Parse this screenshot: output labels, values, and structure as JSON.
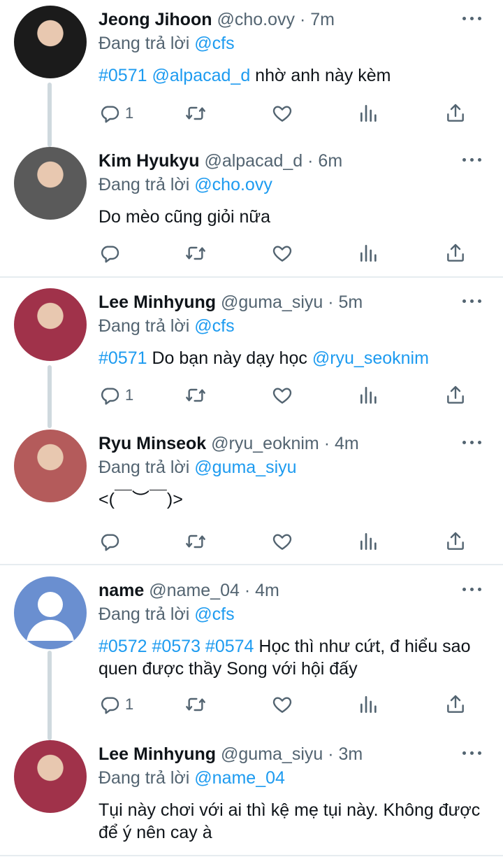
{
  "reply_prefix": "Đang trả lời",
  "tweets": [
    {
      "name": "Jeong Jihoon",
      "handle": "@cho.ovy",
      "time": "7m",
      "reply_to": "@cfs",
      "body_parts": [
        {
          "text": "#0571 @alpacad_d",
          "link": true
        },
        {
          "text": " nhờ anh này kèm",
          "link": false
        }
      ],
      "reply_count": "1",
      "avatar_color": "#1b1b1b"
    },
    {
      "name": "Kim Hyukyu",
      "handle": "@alpacad_d",
      "time": "6m",
      "reply_to": "@cho.ovy",
      "body_parts": [
        {
          "text": "Do mèo cũng giỏi nữa",
          "link": false
        }
      ],
      "reply_count": "",
      "avatar_color": "#5a5a5a"
    },
    {
      "name": "Lee Minhyung",
      "handle": "@guma_siyu",
      "time": "5m",
      "reply_to": "@cfs",
      "body_parts": [
        {
          "text": "#0571",
          "link": true
        },
        {
          "text": " Do bạn này dạy học ",
          "link": false
        },
        {
          "text": "@ryu_seoknim",
          "link": true
        }
      ],
      "reply_count": "1",
      "avatar_color": "#a0324a"
    },
    {
      "name": "Ryu Minseok",
      "handle": "@ryu_eoknim",
      "time": "4m",
      "reply_to": "@guma_siyu",
      "body_parts": [
        {
          "text": "<(￣︶￣)>",
          "link": false
        }
      ],
      "reply_count": "",
      "avatar_color": "#b45b5b"
    },
    {
      "name": "name",
      "handle": "@name_04",
      "time": "4m",
      "reply_to": "@cfs",
      "body_parts": [
        {
          "text": "#0572 #0573 #0574",
          "link": true
        },
        {
          "text": " Học thì như cứt, đ hiểu sao quen được thầy Song với hội đấy",
          "link": false
        }
      ],
      "reply_count": "1",
      "avatar_color": "#6a8fd0"
    },
    {
      "name": "Lee Minhyung",
      "handle": "@guma_siyu",
      "time": "3m",
      "reply_to": "@name_04",
      "body_parts": [
        {
          "text": "Tụi này chơi với ai thì kệ mẹ tụi này. Không được để ý nên cay à",
          "link": false
        }
      ],
      "reply_count": "",
      "avatar_color": "#a0324a"
    }
  ],
  "icons": {
    "reply": "reply-icon",
    "retweet": "retweet-icon",
    "like": "heart-icon",
    "views": "bar-chart-icon",
    "share": "share-icon",
    "more": "more-icon"
  },
  "colors": {
    "link": "#1d9bf0",
    "muted": "#536471",
    "thread_line": "#cfd9de"
  }
}
